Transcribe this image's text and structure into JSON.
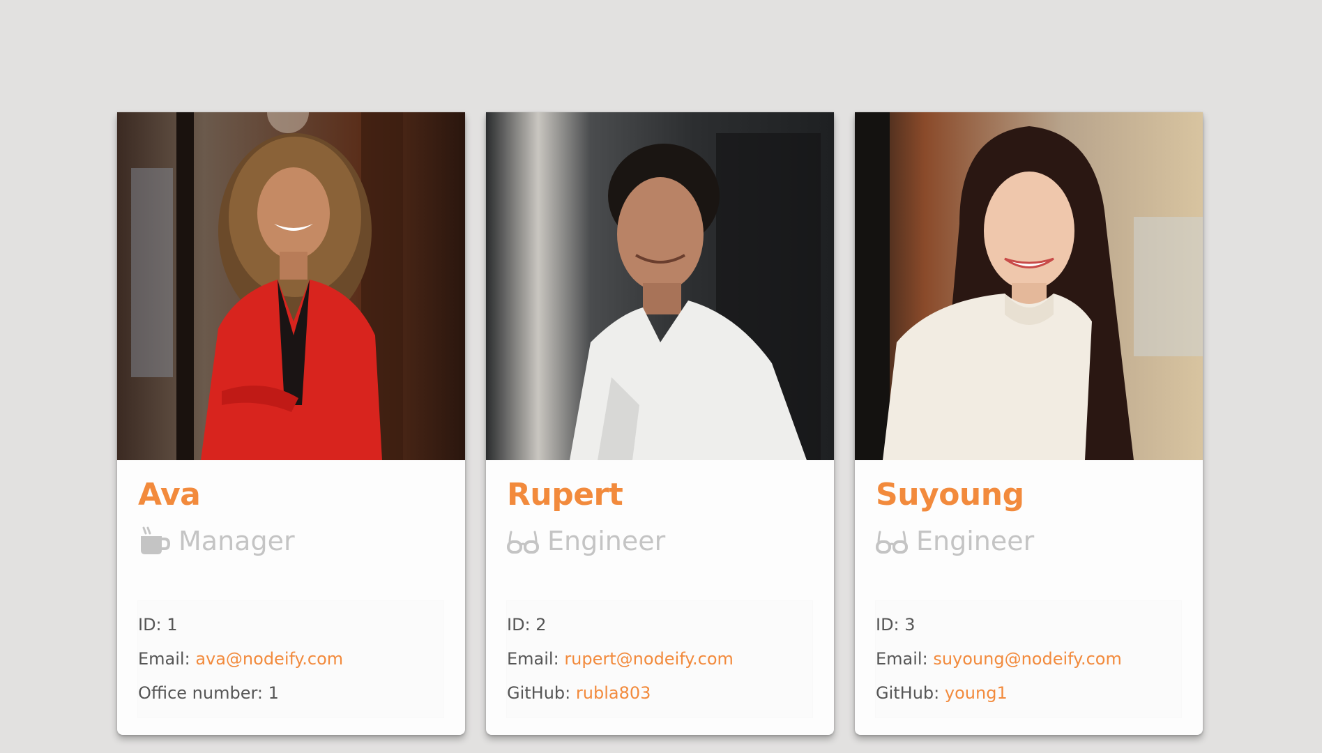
{
  "colors": {
    "background": "#e2e1e0",
    "accent": "#f28a3c",
    "role_text": "#c4c4c4",
    "info_text": "#555555"
  },
  "employees": [
    {
      "name": "Ava",
      "role": "Manager",
      "role_icon": "coffee-mug-icon",
      "photo": "portrait-woman-red-blazer",
      "id_label": "ID:",
      "id": "1",
      "email_label": "Email:",
      "email": "ava@nodeify.com",
      "extra_label": "Office number:",
      "extra_value": "1"
    },
    {
      "name": "Rupert",
      "role": "Engineer",
      "role_icon": "glasses-icon",
      "photo": "portrait-man-white-shirt",
      "id_label": "ID:",
      "id": "2",
      "email_label": "Email:",
      "email": "rupert@nodeify.com",
      "extra_label": "GitHub:",
      "extra_value": "rubla803"
    },
    {
      "name": "Suyoung",
      "role": "Engineer",
      "role_icon": "glasses-icon",
      "photo": "portrait-woman-white-sweater",
      "id_label": "ID:",
      "id": "3",
      "email_label": "Email:",
      "email": "suyoung@nodeify.com",
      "extra_label": "GitHub:",
      "extra_value": "young1"
    }
  ]
}
